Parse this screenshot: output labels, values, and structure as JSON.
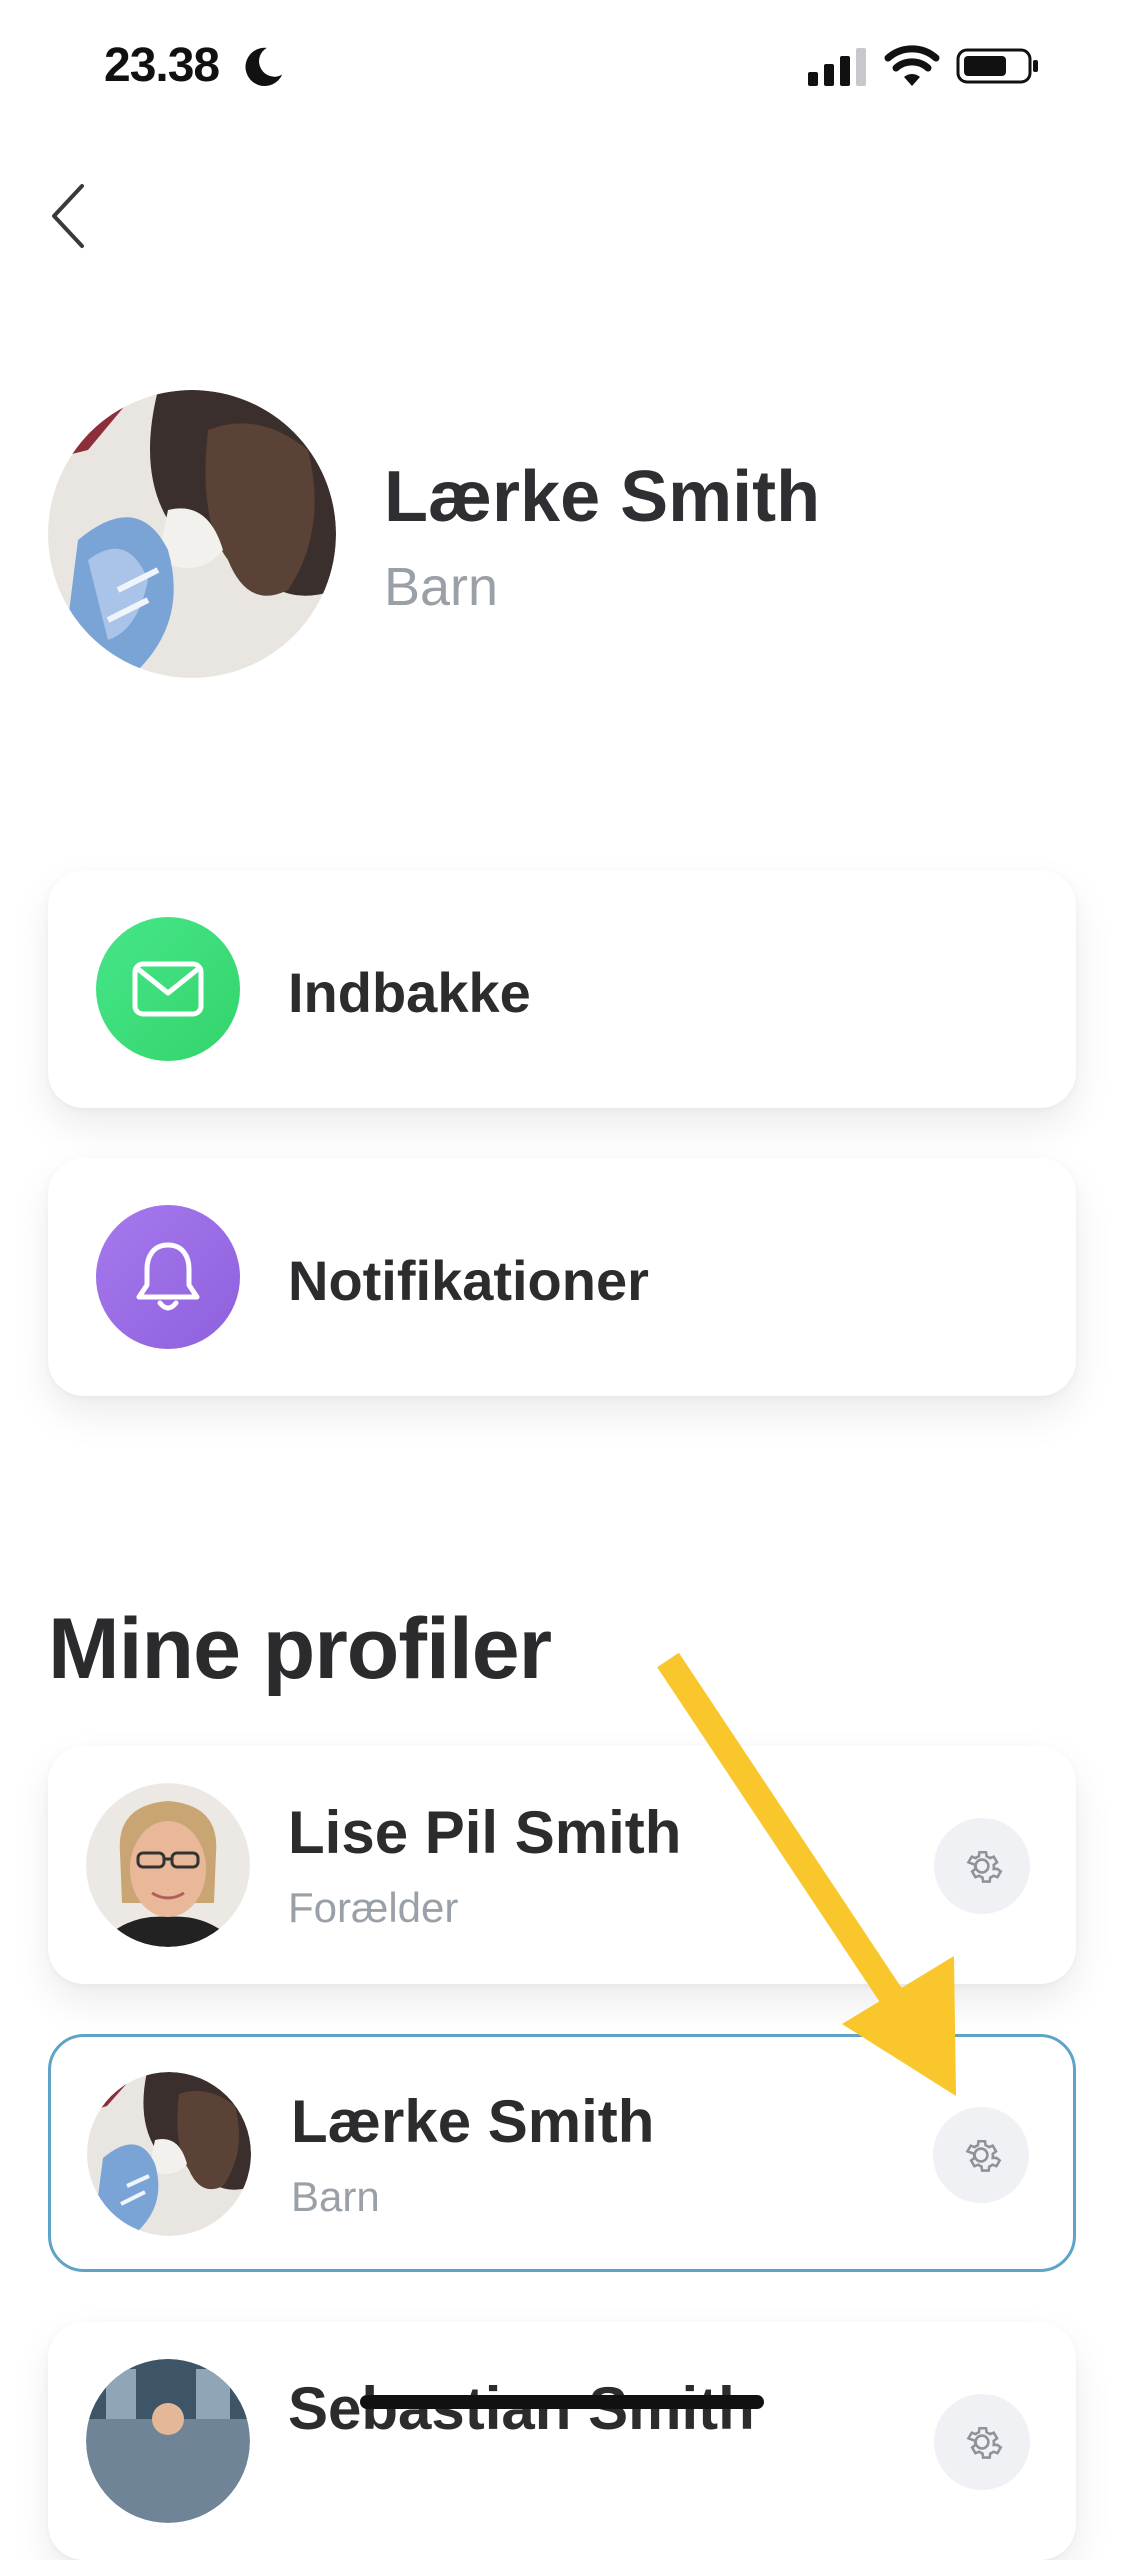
{
  "status_bar": {
    "time": "23.38"
  },
  "header": {
    "name": "Lærke Smith",
    "role": "Barn"
  },
  "menu": [
    {
      "label": "Indbakke",
      "icon": "mail-icon",
      "color": "#3fe07a"
    },
    {
      "label": "Notifikationer",
      "icon": "bell-icon",
      "color": "#9b6ee6"
    }
  ],
  "profiles_section": {
    "title": "Mine profiler",
    "profiles": [
      {
        "name": "Lise Pil Smith",
        "role": "Forælder"
      },
      {
        "name": "Lærke Smith",
        "role": "Barn"
      },
      {
        "name": "Sebastian Smith",
        "role": ""
      }
    ]
  },
  "annotation": {
    "arrow_color": "#f9c62c"
  }
}
